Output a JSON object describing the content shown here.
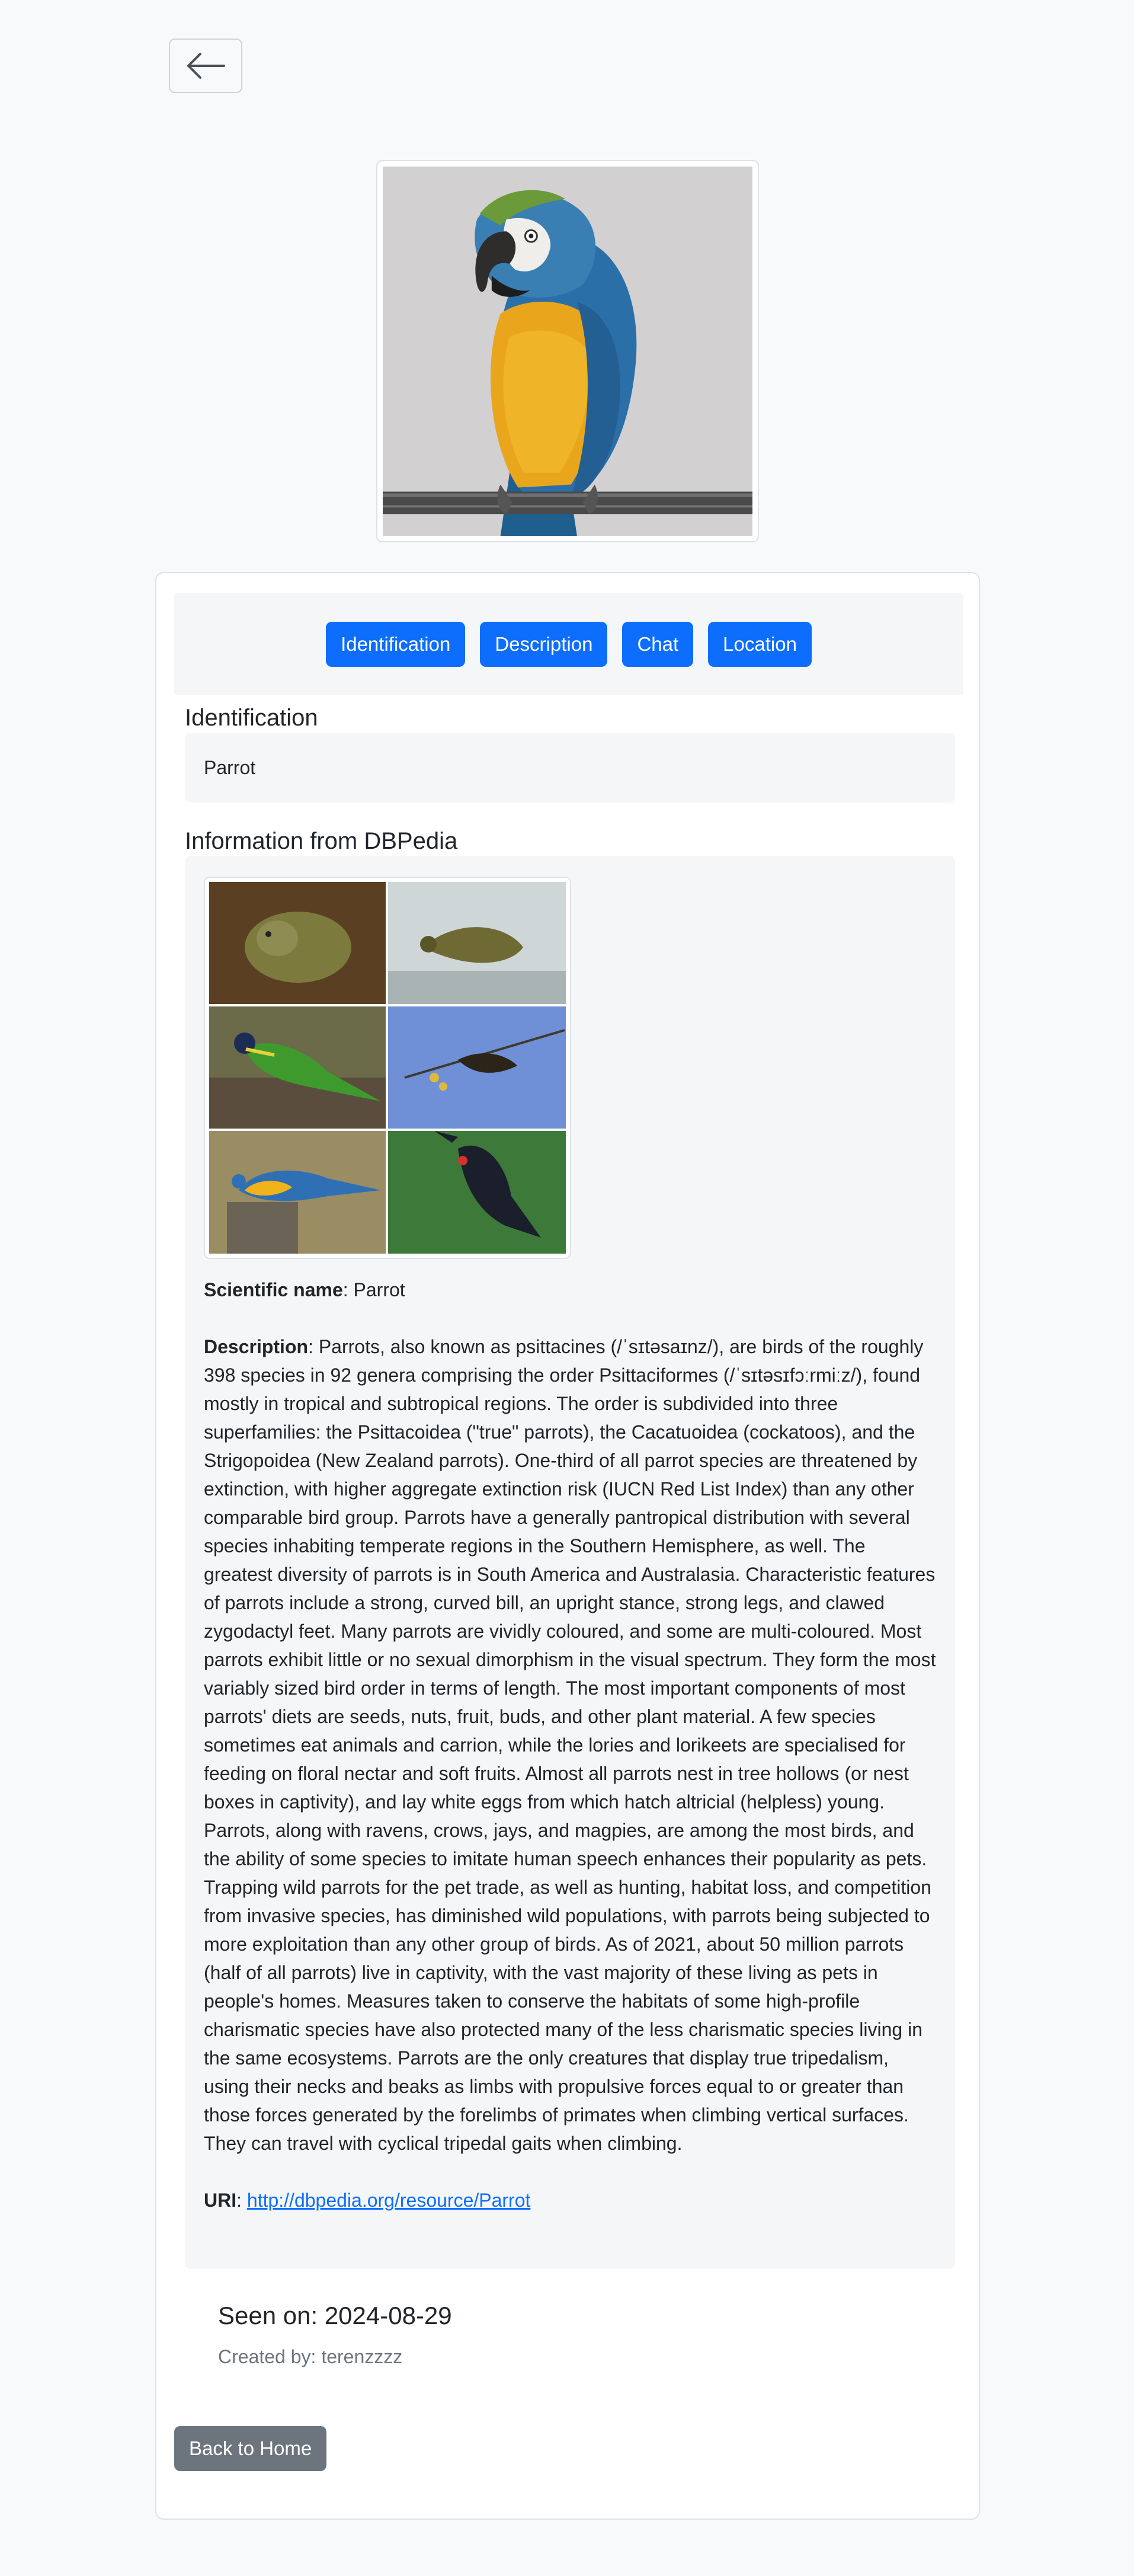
{
  "nav": {
    "back_icon": "arrow-left-icon"
  },
  "tabs": [
    {
      "label": "Identification"
    },
    {
      "label": "Description"
    },
    {
      "label": "Chat"
    },
    {
      "label": "Location"
    }
  ],
  "identification": {
    "heading": "Identification",
    "value": "Parrot"
  },
  "dbpedia": {
    "heading": "Information from DBPedia",
    "scientific_name_label": "Scientific name",
    "scientific_name": "Parrot",
    "description_label": "Description",
    "description": "Parrots, also known as psittacines (/ˈsɪtəsaɪnz/), are birds of the roughly 398 species in 92 genera comprising the order Psittaciformes (/ˈsɪtəsɪfɔːrmiːz/), found mostly in tropical and subtropical regions. The order is subdivided into three superfamilies: the Psittacoidea (\"true\" parrots), the Cacatuoidea (cockatoos), and the Strigopoidea (New Zealand parrots). One-third of all parrot species are threatened by extinction, with higher aggregate extinction risk (IUCN Red List Index) than any other comparable bird group. Parrots have a generally pantropical distribution with several species inhabiting temperate regions in the Southern Hemisphere, as well. The greatest diversity of parrots is in South America and Australasia. Characteristic features of parrots include a strong, curved bill, an upright stance, strong legs, and clawed zygodactyl feet. Many parrots are vividly coloured, and some are multi-coloured. Most parrots exhibit little or no sexual dimorphism in the visual spectrum. They form the most variably sized bird order in terms of length. The most important components of most parrots' diets are seeds, nuts, fruit, buds, and other plant material. A few species sometimes eat animals and carrion, while the lories and lorikeets are specialised for feeding on floral nectar and soft fruits. Almost all parrots nest in tree hollows (or nest boxes in captivity), and lay white eggs from which hatch altricial (helpless) young. Parrots, along with ravens, crows, jays, and magpies, are among the most birds, and the ability of some species to imitate human speech enhances their popularity as pets. Trapping wild parrots for the pet trade, as well as hunting, habitat loss, and competition from invasive species, has diminished wild populations, with parrots being subjected to more exploitation than any other group of birds. As of 2021, about 50 million parrots (half of all parrots) live in captivity, with the vast majority of these living as pets in people's homes. Measures taken to conserve the habitats of some high-profile charismatic species have also protected many of the less charismatic species living in the same ecosystems. Parrots are the only creatures that display true tripedalism, using their necks and beaks as limbs with propulsive forces equal to or greater than those forces generated by the forelimbs of primates when climbing vertical surfaces. They can travel with cyclical tripedal gaits when climbing.",
    "uri_label": "URI",
    "uri": "http://dbpedia.org/resource/Parrot"
  },
  "seen_on": "Seen on: 2024-08-29",
  "created_by": "Created by: terenzzzz",
  "back_home_label": "Back to Home",
  "colors": {
    "primary": "#0d6efd",
    "secondary": "#6c757d",
    "page_bg": "#f8f9fa",
    "panel_bg": "#f5f6f7"
  }
}
